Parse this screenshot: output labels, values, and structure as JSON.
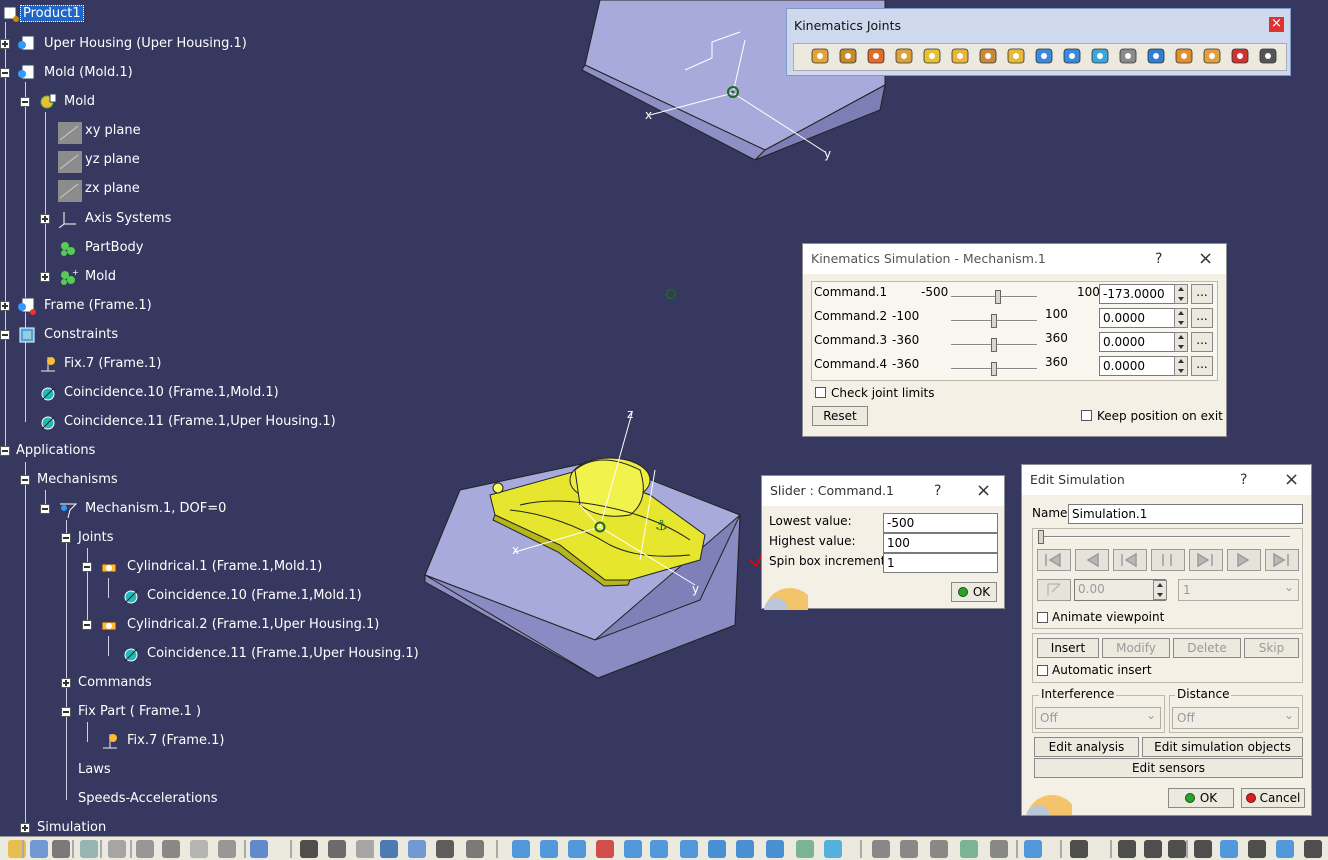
{
  "tree": {
    "nodes": [
      {
        "id": "product1",
        "label": "Product1",
        "selected": true
      },
      {
        "id": "uper-housing",
        "label": "Uper Housing (Uper Housing.1)"
      },
      {
        "id": "mold-inst",
        "label": "Mold (Mold.1)"
      },
      {
        "id": "mold-part",
        "label": "Mold"
      },
      {
        "id": "xy-plane",
        "label": "xy plane"
      },
      {
        "id": "yz-plane",
        "label": "yz plane"
      },
      {
        "id": "zx-plane",
        "label": "zx plane"
      },
      {
        "id": "axis-systems",
        "label": "Axis Systems"
      },
      {
        "id": "partbody",
        "label": "PartBody"
      },
      {
        "id": "mold-body",
        "label": "Mold"
      },
      {
        "id": "frame",
        "label": "Frame (Frame.1)"
      },
      {
        "id": "constraints",
        "label": "Constraints"
      },
      {
        "id": "fix7",
        "label": "Fix.7 (Frame.1)"
      },
      {
        "id": "coincidence10",
        "label": "Coincidence.10 (Frame.1,Mold.1)"
      },
      {
        "id": "coincidence11",
        "label": "Coincidence.11 (Frame.1,Uper Housing.1)"
      },
      {
        "id": "applications",
        "label": "Applications"
      },
      {
        "id": "mechanisms",
        "label": "Mechanisms"
      },
      {
        "id": "mechanism1",
        "label": "Mechanism.1, DOF=0"
      },
      {
        "id": "joints",
        "label": "Joints"
      },
      {
        "id": "cylindrical1",
        "label": "Cylindrical.1 (Frame.1,Mold.1)"
      },
      {
        "id": "j-coincidence10",
        "label": "Coincidence.10 (Frame.1,Mold.1)"
      },
      {
        "id": "cylindrical2",
        "label": "Cylindrical.2 (Frame.1,Uper Housing.1)"
      },
      {
        "id": "j-coincidence11",
        "label": "Coincidence.11 (Frame.1,Uper Housing.1)"
      },
      {
        "id": "commands",
        "label": "Commands"
      },
      {
        "id": "fix-part",
        "label": "Fix Part ( Frame.1 )"
      },
      {
        "id": "fp-fix7",
        "label": "Fix.7 (Frame.1)"
      },
      {
        "id": "laws",
        "label": "Laws"
      },
      {
        "id": "speeds",
        "label": "Speeds-Accelerations"
      },
      {
        "id": "simulation",
        "label": "Simulation"
      }
    ]
  },
  "viewport": {
    "axis_labels": {
      "top_x": "x",
      "top_y": "y",
      "z": "z",
      "bottom_x": "x",
      "bottom_y": "y"
    },
    "colors": {
      "background": "#37385f",
      "block": "#a9aadc",
      "part": "#e6e62e"
    }
  },
  "kinematics_toolbar": {
    "title": "Kinematics Joints",
    "close": "×",
    "icons": [
      "revolute-joint-icon",
      "prismatic-joint-icon",
      "cylindrical-joint-icon",
      "screw-joint-icon",
      "spherical-joint-icon",
      "planar-joint-icon",
      "rigid-joint-icon",
      "point-curve-joint-icon",
      "slide-curve-joint-icon",
      "roll-curve-joint-icon",
      "point-surface-joint-icon",
      "universal-joint-icon",
      "cv-joint-icon",
      "gear-joint-icon",
      "rack-joint-icon",
      "cable-joint-icon",
      "axis-system-joint-icon"
    ]
  },
  "kin_sim": {
    "title": "Kinematics Simulation - Mechanism.1",
    "help": "?",
    "close": "×",
    "commands": [
      {
        "name": "Command.1",
        "min": "-500",
        "max": "100",
        "value": "-173.0000",
        "fraction": 0.55
      },
      {
        "name": "Command.2",
        "min": "-100",
        "max": "100",
        "value": "0.0000",
        "fraction": 0.5
      },
      {
        "name": "Command.3",
        "min": "-360",
        "max": "360",
        "value": "0.0000",
        "fraction": 0.5
      },
      {
        "name": "Command.4",
        "min": "-360",
        "max": "360",
        "value": "0.0000",
        "fraction": 0.5
      }
    ],
    "more_label": "...",
    "check_joint_limits": "Check joint limits",
    "reset": "Reset",
    "keep_position": "Keep position on exit"
  },
  "slider_dlg": {
    "title": "Slider : Command.1",
    "help": "?",
    "close": "×",
    "lowest_label": "Lowest value:",
    "lowest_value": "-500",
    "highest_label": "Highest value:",
    "highest_value": "100",
    "spin_label": "Spin box increments:",
    "spin_value": "1",
    "ok": "OK"
  },
  "edit_sim": {
    "title": "Edit Simulation",
    "help": "?",
    "close": "×",
    "name_label": "Name:",
    "name_value": "Simulation.1",
    "step_value": "0.00",
    "step_count": "1",
    "animate_viewpoint": "Animate viewpoint",
    "insert": "Insert",
    "modify": "Modify",
    "delete": "Delete",
    "skip": "Skip",
    "automatic_insert": "Automatic insert",
    "interference_label": "Interference",
    "interference_value": "Off",
    "distance_label": "Distance",
    "distance_value": "Off",
    "edit_analysis": "Edit analysis",
    "edit_sim_objects": "Edit simulation objects",
    "edit_sensors": "Edit sensors",
    "ok": "OK",
    "cancel": "Cancel"
  }
}
